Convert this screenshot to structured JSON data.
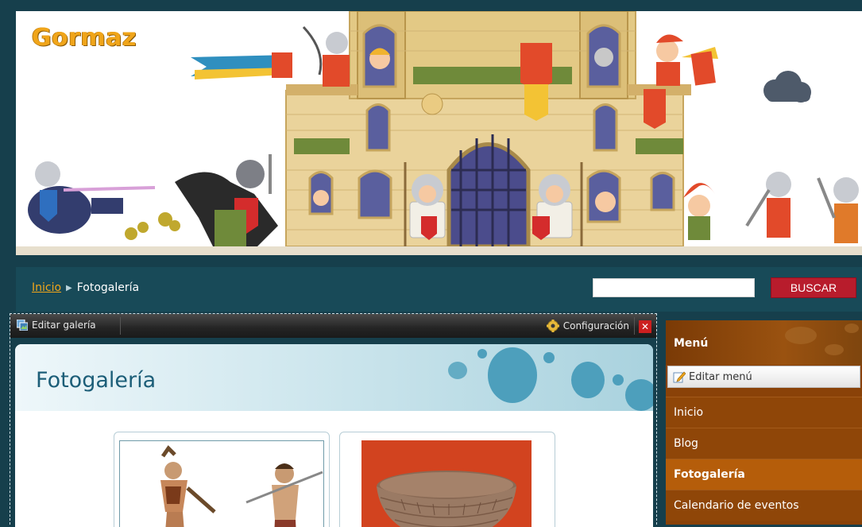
{
  "site": {
    "title": "Gormaz"
  },
  "breadcrumb": {
    "home": "Inicio",
    "current": "Fotogalería"
  },
  "search": {
    "value": "",
    "button": "BUSCAR"
  },
  "edit_toolbar": {
    "edit_gallery": "Editar galería",
    "configuration": "Configuración",
    "close": "✕"
  },
  "gallery": {
    "title": "Fotogalería"
  },
  "sidebar": {
    "title": "Menú",
    "edit_menu": "Editar menú",
    "items": [
      {
        "label": "Inicio",
        "active": false
      },
      {
        "label": "Blog",
        "active": false
      },
      {
        "label": "Fotogalería",
        "active": true
      },
      {
        "label": "Calendario de eventos",
        "active": false
      }
    ]
  },
  "colors": {
    "background": "#163f4c",
    "accent": "#f0a51a",
    "search_button": "#b81c2c",
    "sidebar": "#8a4208",
    "sidebar_active": "#b55d0a",
    "gallery_title": "#1c5e78"
  }
}
